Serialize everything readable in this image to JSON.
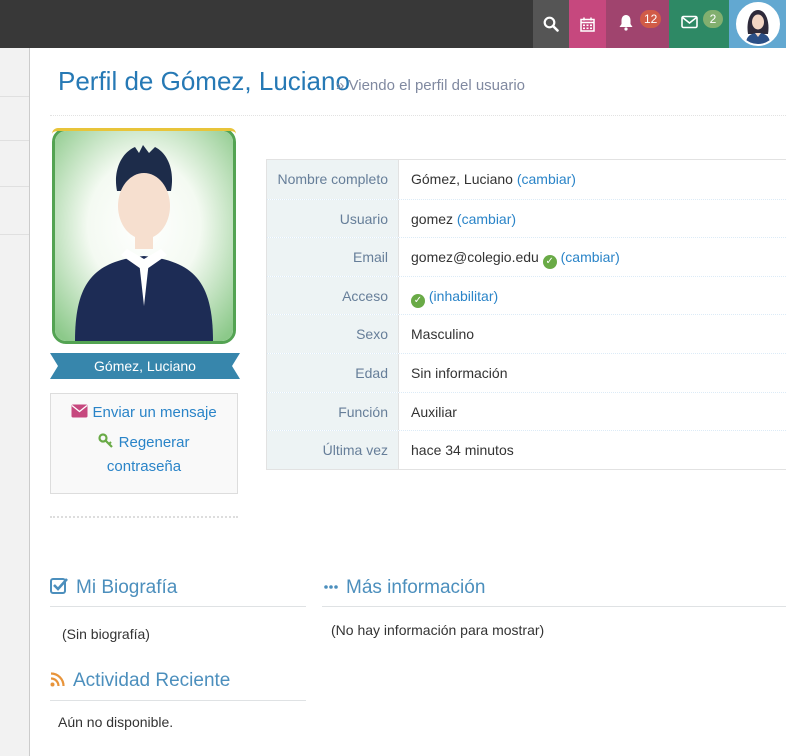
{
  "navbar": {
    "search_icon": "search-icon",
    "calendar_icon": "calendar-icon",
    "notifications_count": "12",
    "messages_count": "2",
    "colors": {
      "bg": "#383838",
      "search": "#555555",
      "calendar": "#c6487e",
      "bell": "#a0446e",
      "mail": "#2e8965",
      "avatar": "#62a8d1"
    }
  },
  "header": {
    "title": "Perfil de Gómez, Luciano",
    "subtitle": "» Viendo el perfil del usuario"
  },
  "profile": {
    "name": "Gómez, Luciano",
    "send_message": "Enviar un mensaje",
    "regenerate_password": "Regenerar contraseña"
  },
  "info": {
    "rows": [
      {
        "label": "Nombre completo",
        "value": "Gómez, Luciano",
        "link": "(cambiar)"
      },
      {
        "label": "Usuario",
        "value": "gomez",
        "link": "(cambiar)"
      },
      {
        "label": "Email",
        "value": "gomez@colegio.edu",
        "link": "(cambiar)"
      },
      {
        "label": "Acceso",
        "value": "",
        "link": "(inhabilitar)"
      },
      {
        "label": "Sexo",
        "value": "Masculino",
        "link": ""
      },
      {
        "label": "Edad",
        "value": "Sin información",
        "link": ""
      },
      {
        "label": "Función",
        "value": "Auxiliar",
        "link": ""
      },
      {
        "label": "Última vez",
        "value": "hace 34 minutos",
        "link": ""
      }
    ]
  },
  "biography": {
    "title": "Mi Biografía",
    "body": "(Sin biografía)"
  },
  "more_info": {
    "title": "Más información",
    "body": "(No hay información para mostrar)"
  },
  "activity": {
    "title": "Actividad Reciente",
    "body": "Aún no disponible."
  }
}
